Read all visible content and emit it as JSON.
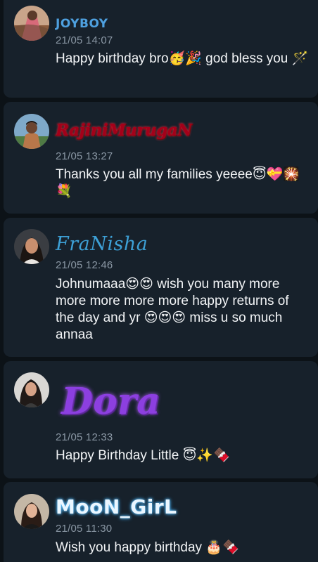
{
  "comments": [
    {
      "name": "JOYBOY",
      "time": "21/05 14:07",
      "text": "Happy birthday bro🥳🎉 god bless you 🪄"
    },
    {
      "name": "RajiniMurugaN",
      "time": "21/05 13:27",
      "text": "Thanks you all my families yeeee😇💝🎇💐"
    },
    {
      "name": "FraNisha",
      "time": "21/05 12:46",
      "text": "Johnumaaa😍😍 wish you many more more more more more happy returns of the day and yr 😍😍😍 miss u so much annaa"
    },
    {
      "name": "Dora",
      "time": "21/05 12:33",
      "text": "Happy Birthday Little 😇✨🍫"
    },
    {
      "name": "MooN_GirL",
      "time": "21/05 11:30",
      "text": "Wish you happy birthday 🎂🍫"
    }
  ]
}
